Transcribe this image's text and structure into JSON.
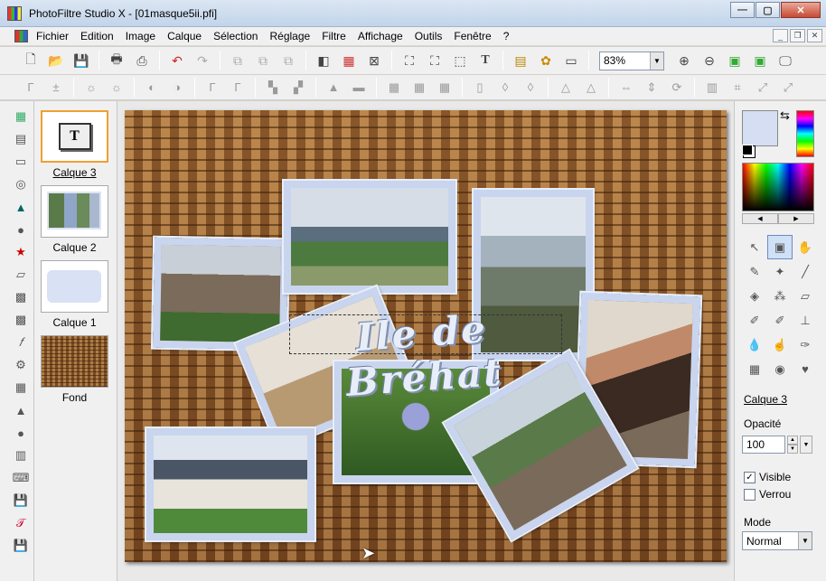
{
  "window": {
    "title": "PhotoFiltre Studio X - [01masque5ii.pfi]",
    "minimize_glyph": "—",
    "maximize_glyph": "▢",
    "close_glyph": "✕"
  },
  "menu": {
    "items": [
      "Fichier",
      "Edition",
      "Image",
      "Calque",
      "Sélection",
      "Réglage",
      "Filtre",
      "Affichage",
      "Outils",
      "Fenêtre",
      "?"
    ],
    "mdi_minimize": "_",
    "mdi_restore": "❐",
    "mdi_close": "✕"
  },
  "toolbar": {
    "zoom_value": "83%",
    "zoom_arrow": "▼"
  },
  "layers": {
    "items": [
      {
        "name": "Calque 3",
        "thumb_glyph": "T"
      },
      {
        "name": "Calque 2"
      },
      {
        "name": "Calque 1"
      },
      {
        "name": "Fond"
      }
    ]
  },
  "canvas": {
    "overlay_text": "Ile de Bréhat"
  },
  "right_panel": {
    "active_layer": "Calque 3",
    "opacity_label": "Opacité",
    "opacity_value": "100",
    "visible_label": "Visible",
    "visible_checked": "✓",
    "lock_label": "Verrou",
    "mode_label": "Mode",
    "mode_value": "Normal",
    "colors": {
      "foreground": "#d5def3",
      "accent_selected_layer": "#f0a030"
    }
  }
}
